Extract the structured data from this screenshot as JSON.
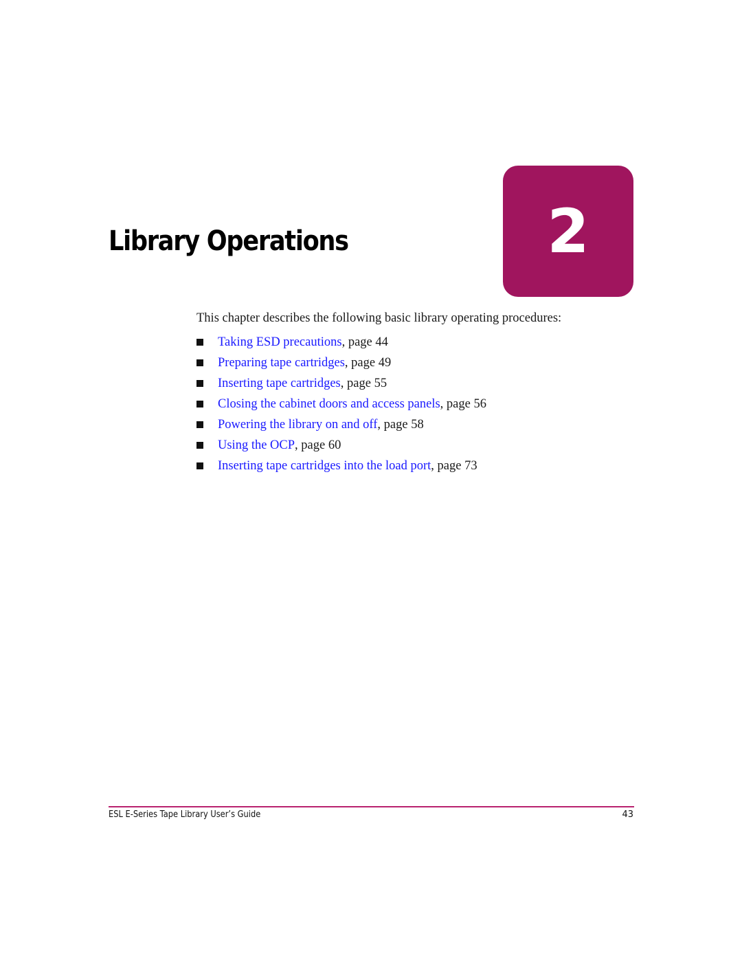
{
  "chapter": {
    "title": "Library Operations",
    "number": "2",
    "badge_color": "#a0155e"
  },
  "intro": "This chapter describes the following basic library operating procedures:",
  "toc": [
    {
      "link": "Taking ESD precautions",
      "suffix": ", page 44"
    },
    {
      "link": "Preparing tape cartridges",
      "suffix": ", page 49"
    },
    {
      "link": "Inserting tape cartridges",
      "suffix": ", page 55"
    },
    {
      "link": "Closing the cabinet doors and access panels",
      "suffix": ", page 56"
    },
    {
      "link": "Powering the library on and off",
      "suffix": ", page 58"
    },
    {
      "link": "Using the OCP",
      "suffix": ", page 60"
    },
    {
      "link": "Inserting tape cartridges into the load port",
      "suffix": ", page 73"
    }
  ],
  "footer": {
    "title": "ESL E-Series Tape Library User’s Guide",
    "page_number": "43",
    "rule_color": "#b8216e"
  },
  "colors": {
    "link": "#1a1aff"
  }
}
